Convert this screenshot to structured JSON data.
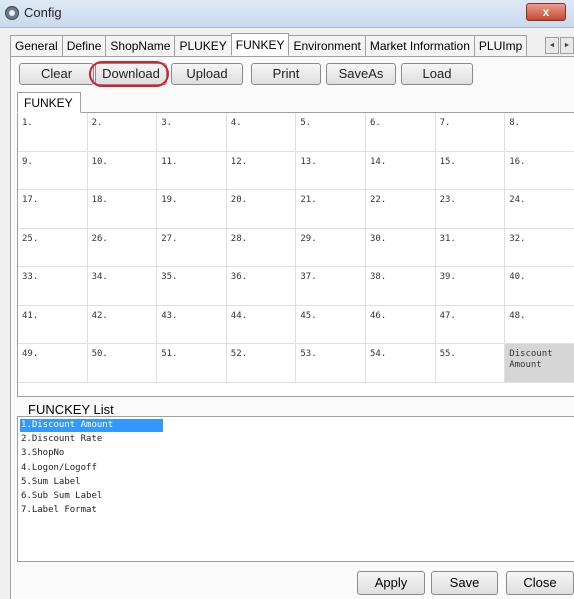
{
  "window": {
    "title": "Config",
    "close_glyph": "x"
  },
  "tabs": [
    "General",
    "Define",
    "ShopName",
    "PLUKEY",
    "FUNKEY",
    "Environment",
    "Market Information",
    "PLUImp"
  ],
  "active_tab": "FUNKEY",
  "tab_scroll": {
    "left": "◄",
    "right": "►"
  },
  "toolbar": {
    "clear": "Clear",
    "download": "Download",
    "upload": "Upload",
    "print": "Print",
    "saveas": "SaveAs",
    "load": "Load"
  },
  "subtab": "FUNKEY",
  "keys": [
    "1.",
    "2.",
    "3.",
    "4.",
    "5.",
    "6.",
    "7.",
    "8.",
    "9.",
    "10.",
    "11.",
    "12.",
    "13.",
    "14.",
    "15.",
    "16.",
    "17.",
    "18.",
    "19.",
    "20.",
    "21.",
    "22.",
    "23.",
    "24.",
    "25.",
    "26.",
    "27.",
    "28.",
    "29.",
    "30.",
    "31.",
    "32.",
    "33.",
    "34.",
    "35.",
    "36.",
    "37.",
    "38.",
    "39.",
    "40.",
    "41.",
    "42.",
    "43.",
    "44.",
    "45.",
    "46.",
    "47.",
    "48.",
    "49.",
    "50.",
    "51.",
    "52.",
    "53.",
    "54.",
    "55.",
    "Discount Amount"
  ],
  "funckey_list": {
    "label": "FUNCKEY List",
    "items": [
      "1.Discount Amount",
      "2.Discount Rate",
      "3.ShopNo",
      "4.Logon/Logoff",
      "5.Sum Label",
      "6.Sub Sum Label",
      "7.Label Format"
    ]
  },
  "footer": {
    "apply": "Apply",
    "save": "Save",
    "close": "Close"
  }
}
